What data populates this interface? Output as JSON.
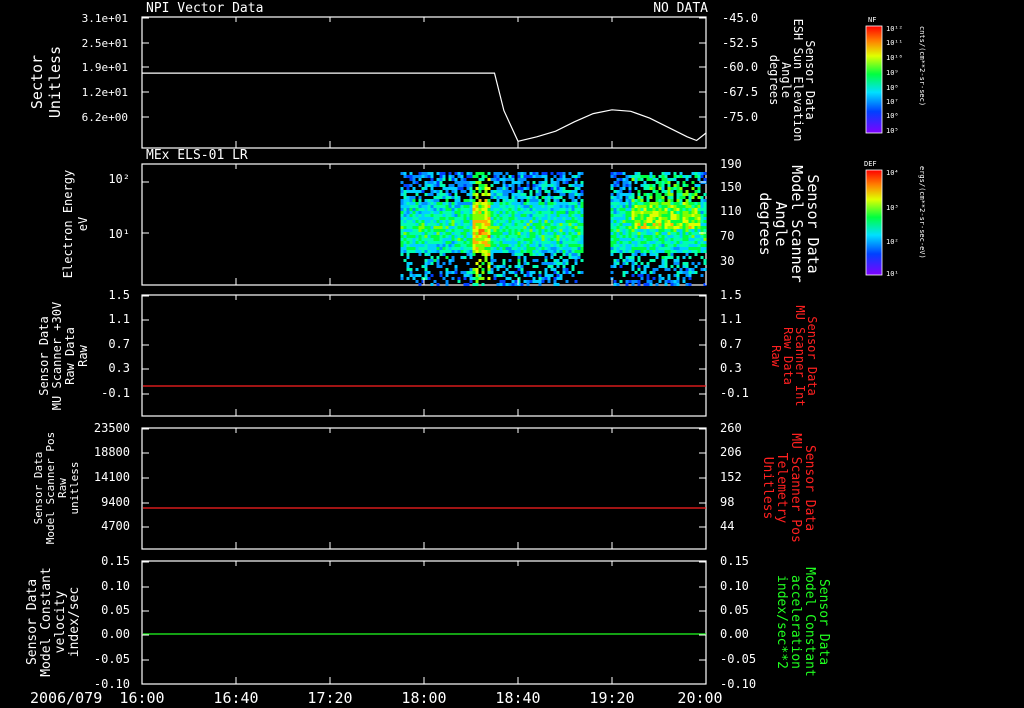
{
  "panel1": {
    "title_left": "NPI Vector Data",
    "title_right": "NO DATA",
    "ylabel_left": [
      "Sector",
      "Unitless"
    ],
    "ylabel_right": [
      "Sensor Data",
      "ESH Sun Elevation",
      "Angle",
      "degrees"
    ],
    "left_ticks": [
      "3.1e+01",
      "2.5e+01",
      "1.9e+01",
      "1.2e+01",
      "6.2e+00"
    ],
    "right_ticks": [
      "-45.0",
      "-52.5",
      "-60.0",
      "-67.5",
      "-75.0"
    ]
  },
  "panel2": {
    "title_left": "MEx ELS-01 LR",
    "ylabel_left": [
      "Electron Energy",
      "eV"
    ],
    "ylabel_right": [
      "Sensor Data",
      "Model Scanner",
      "Angle",
      "degrees"
    ],
    "left_ticks": [
      "10²",
      "10¹"
    ],
    "right_ticks": [
      "190",
      "150",
      "110",
      "70",
      "30"
    ]
  },
  "panel3": {
    "ylabel_left": [
      "Sensor Data",
      "MU Scanner +30V",
      "Raw Data",
      "Raw"
    ],
    "ylabel_right": [
      "Sensor Data",
      "MU Scanner Int",
      "Raw Data",
      "Raw"
    ],
    "left_ticks": [
      "1.5",
      "1.1",
      "0.7",
      "0.3",
      "-0.1"
    ],
    "right_ticks": [
      "1.5",
      "1.1",
      "0.7",
      "0.3",
      "-0.1"
    ]
  },
  "panel4": {
    "ylabel_left": [
      "Sensor Data",
      "Model Scanner Pos",
      "Raw",
      "unitless"
    ],
    "ylabel_right": [
      "Sensor Data",
      "MU Scanner Pos",
      "Telemetry",
      "Unitless"
    ],
    "left_ticks": [
      "23500",
      "18800",
      "14100",
      "9400",
      "4700"
    ],
    "right_ticks": [
      "260",
      "206",
      "152",
      "98",
      "44"
    ]
  },
  "panel5": {
    "ylabel_left": [
      "Sensor Data",
      "Model Constant",
      "velocity",
      "index/sec"
    ],
    "ylabel_right": [
      "Sensor Data",
      "Model Constant",
      "acceleration",
      "index/sec**2"
    ],
    "left_ticks": [
      "0.15",
      "0.10",
      "0.05",
      "0.00",
      "-0.05",
      "-0.10"
    ],
    "right_ticks": [
      "0.15",
      "0.10",
      "0.05",
      "0.00",
      "-0.05",
      "-0.10"
    ]
  },
  "xaxis": {
    "date": "2006/079",
    "ticks": [
      "16:00",
      "16:40",
      "17:20",
      "18:00",
      "18:40",
      "19:20",
      "20:00"
    ]
  },
  "colorbar1": {
    "label": "NF",
    "units": "cnts/(cm**2-sr-sec)",
    "ticks": [
      "10¹²",
      "10¹¹",
      "10¹⁰",
      "10⁹",
      "10⁸",
      "10⁷",
      "10⁶",
      "10⁵"
    ]
  },
  "colorbar2": {
    "label": "DEF",
    "units": "ergs/(cm**2-sr-sec-eV)",
    "ticks": [
      "10⁴",
      "10³",
      "10²",
      "10¹"
    ]
  },
  "colors": {
    "background": "#000000",
    "axis": "#ffffff",
    "red_trace": "#ff2020",
    "green_trace": "#20ff20",
    "red_label": "#ff2020",
    "green_label": "#20ff20"
  },
  "chart_data": [
    {
      "type": "line",
      "x_range": [
        "16:00",
        "20:00"
      ],
      "series": [
        {
          "axis": "right",
          "x": [
            "16:00",
            "18:30",
            "18:34",
            "18:40",
            "18:48",
            "18:56",
            "19:04",
            "19:12",
            "19:20",
            "19:28",
            "19:36",
            "19:44",
            "19:52",
            "19:56",
            "20:00"
          ],
          "y": [
            -60.0,
            -60.0,
            -70.0,
            -78.2,
            -77.0,
            -75.5,
            -73.0,
            -70.8,
            -69.8,
            -70.2,
            -72.0,
            -74.5,
            -77.0,
            -78.0,
            -76.0
          ]
        }
      ],
      "ylim_left": [
        0,
        31
      ],
      "ylim_right": [
        -80,
        -45
      ]
    },
    {
      "type": "heatmap",
      "x_range": [
        "16:00",
        "20:00"
      ],
      "data_start": "17:50",
      "ylabel_scale": "log",
      "ylim": [
        2,
        170
      ]
    },
    {
      "type": "line",
      "series": [
        {
          "color": "red",
          "x": [
            "16:00",
            "20:00"
          ],
          "y": [
            -0.1,
            -0.1
          ]
        }
      ],
      "ylim": [
        -0.3,
        1.5
      ]
    },
    {
      "type": "line",
      "series": [
        {
          "color": "red",
          "x": [
            "16:00",
            "20:00"
          ],
          "y": [
            86,
            86
          ]
        }
      ],
      "ylim_right": [
        0,
        260
      ]
    },
    {
      "type": "line",
      "series": [
        {
          "color": "green",
          "x": [
            "16:00",
            "20:00"
          ],
          "y": [
            0.0,
            0.0
          ]
        }
      ],
      "ylim": [
        -0.1,
        0.15
      ]
    }
  ]
}
